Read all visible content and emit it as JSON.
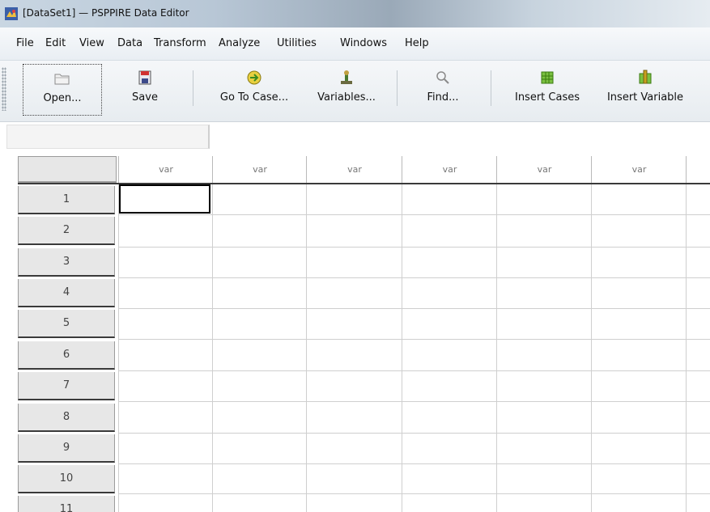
{
  "window": {
    "title": "[DataSet1] — PSPPIRE Data Editor"
  },
  "menu": [
    "File",
    "Edit",
    "View",
    "Data",
    "Transform",
    "Analyze",
    "Utilities",
    "Windows",
    "Help"
  ],
  "toolbar": {
    "open": "Open...",
    "save": "Save",
    "goto_case": "Go To Case...",
    "variables": "Variables...",
    "find": "Find...",
    "insert_cases": "Insert Cases",
    "insert_variable": "Insert Variable"
  },
  "entry": {
    "cell_ref": ""
  },
  "grid": {
    "columns": [
      "var",
      "var",
      "var",
      "var",
      "var",
      "var"
    ],
    "rows": [
      "1",
      "2",
      "3",
      "4",
      "5",
      "6",
      "7",
      "8",
      "9",
      "10",
      "11"
    ]
  },
  "colors": {
    "selected_border": "#000000",
    "header_bg": "#e7e7e7",
    "grid_line": "#cfcfcf"
  }
}
